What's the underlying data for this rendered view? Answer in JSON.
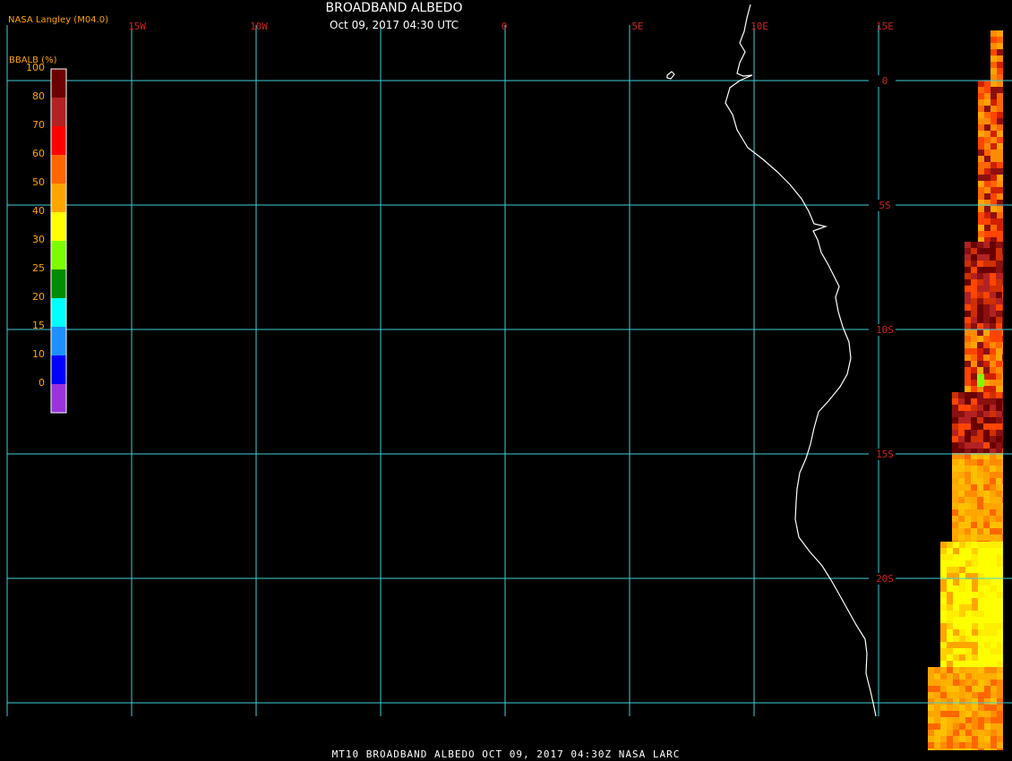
{
  "header": {
    "agency": "NASA Langley (M04.0)",
    "title": "BROADBAND ALBEDO",
    "subtitle": "Oct 09, 2017 04:30 UTC"
  },
  "footer": {
    "text": "MT10  BROADBAND ALBEDO   OCT 09, 2017 04:30Z   NASA LARC"
  },
  "colorbar": {
    "label": "BBALB (%)",
    "ticks": [
      "0",
      "10",
      "15",
      "20",
      "25",
      "30",
      "40",
      "50",
      "60",
      "70",
      "80",
      "100"
    ],
    "colors": [
      "#9933dd",
      "#0000ff",
      "#1e90ff",
      "#00ffff",
      "#008b00",
      "#7cfc00",
      "#ffff00",
      "#ffa500",
      "#ff6600",
      "#ff0000",
      "#b22222",
      "#6b0000"
    ]
  },
  "grid": {
    "lon_labels": [
      "15W",
      "10W",
      "0",
      "5E",
      "10E",
      "15E"
    ],
    "lat_labels": [
      "0",
      "5S",
      "10S",
      "15S",
      "20S"
    ],
    "line_color": "#3fd0d8",
    "label_color": "#cc2222"
  },
  "colors": {
    "coastline": "#ffffff",
    "background": "#000000"
  }
}
